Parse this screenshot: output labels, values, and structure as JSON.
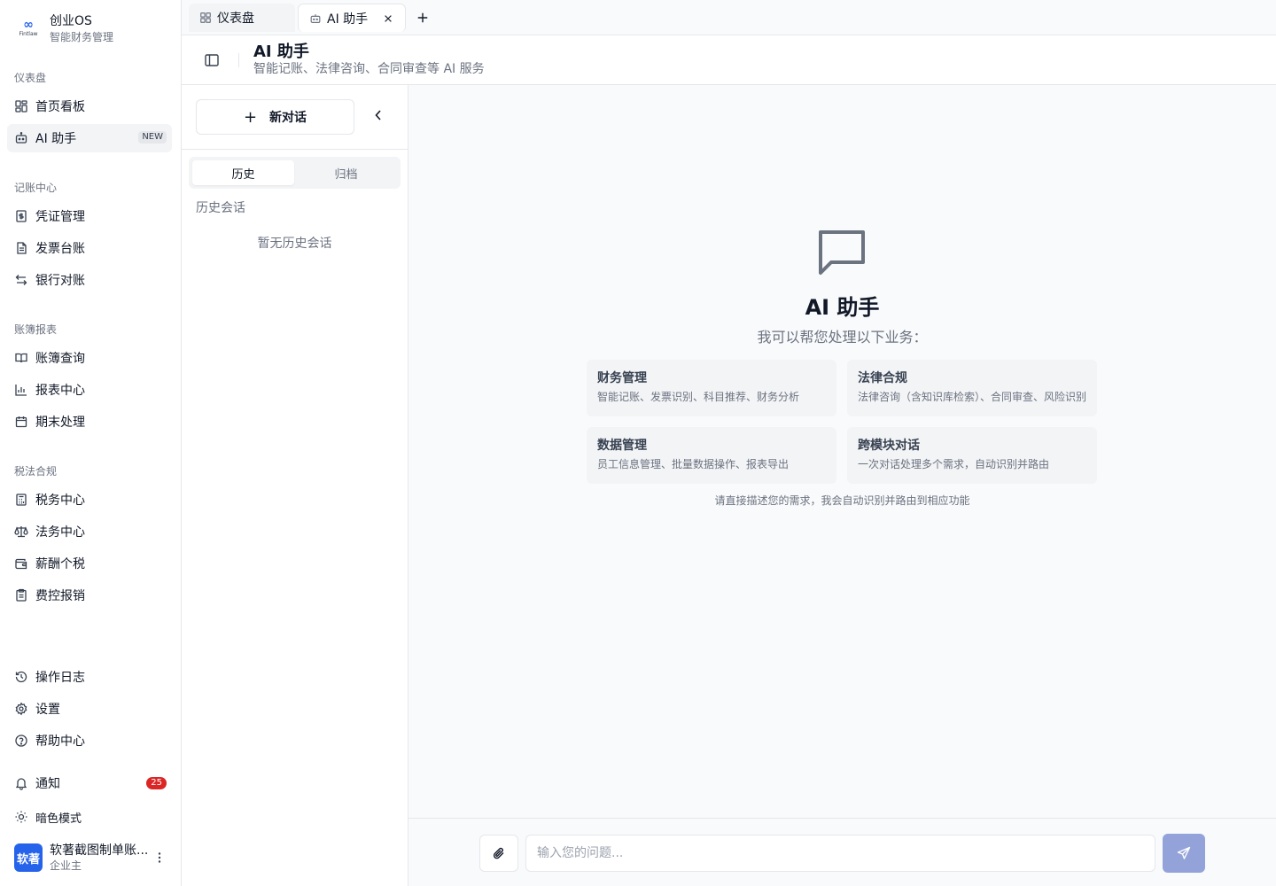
{
  "brand": {
    "logo_text": "Fintlaw",
    "name": "创业OS",
    "tagline": "智能财务管理"
  },
  "sidebar": {
    "sections": [
      {
        "title": "仪表盘",
        "items": [
          {
            "label": "首页看板",
            "icon": "dashboard-icon"
          },
          {
            "label": "AI 助手",
            "icon": "bot-icon",
            "badge": "NEW",
            "active": true
          }
        ]
      },
      {
        "title": "记账中心",
        "items": [
          {
            "label": "凭证管理",
            "icon": "voucher-icon"
          },
          {
            "label": "发票台账",
            "icon": "invoice-icon"
          },
          {
            "label": "银行对账",
            "icon": "transfer-icon"
          }
        ]
      },
      {
        "title": "账簿报表",
        "items": [
          {
            "label": "账簿查询",
            "icon": "book-icon"
          },
          {
            "label": "报表中心",
            "icon": "bar-chart-icon"
          },
          {
            "label": "期末处理",
            "icon": "calendar-icon"
          }
        ]
      },
      {
        "title": "税法合规",
        "items": [
          {
            "label": "税务中心",
            "icon": "calculator-icon"
          },
          {
            "label": "法务中心",
            "icon": "scale-icon"
          },
          {
            "label": "薪酬个税",
            "icon": "wallet-icon"
          },
          {
            "label": "费控报销",
            "icon": "receipt-icon"
          }
        ]
      }
    ],
    "bottom": [
      {
        "label": "操作日志",
        "icon": "history-icon"
      },
      {
        "label": "设置",
        "icon": "gear-icon"
      },
      {
        "label": "帮助中心",
        "icon": "help-icon"
      }
    ],
    "notifications": {
      "label": "通知",
      "count": "25"
    },
    "dark_mode": {
      "label": "暗色模式"
    },
    "user": {
      "avatar_text": "软著",
      "name": "软著截图制单账...",
      "role": "企业主"
    }
  },
  "tabs": [
    {
      "label": "仪表盘",
      "icon": "grid-icon"
    },
    {
      "label": "AI 助手",
      "icon": "bot-icon",
      "active": true
    }
  ],
  "header": {
    "title": "AI 助手",
    "subtitle": "智能记账、法律咨询、合同审查等 AI 服务"
  },
  "conversations": {
    "new_chat_label": "新对话",
    "tabs": [
      "历史",
      "归档"
    ],
    "history_label": "历史会话",
    "empty_text": "暂无历史会话"
  },
  "welcome": {
    "title": "AI 助手",
    "subtitle": "我可以帮您处理以下业务：",
    "cards": [
      {
        "title": "财务管理",
        "desc": "智能记账、发票识别、科目推荐、财务分析"
      },
      {
        "title": "法律合规",
        "desc": "法律咨询（含知识库检索）、合同审查、风险识别"
      },
      {
        "title": "数据管理",
        "desc": "员工信息管理、批量数据操作、报表导出"
      },
      {
        "title": "跨模块对话",
        "desc": "一次对话处理多个需求，自动识别并路由"
      }
    ],
    "hint": "请直接描述您的需求，我会自动识别并路由到相应功能"
  },
  "composer": {
    "placeholder": "输入您的问题..."
  },
  "colors": {
    "accent": "#2563eb",
    "send_disabled": "#93a3d9",
    "badge_red": "#dc2626"
  }
}
